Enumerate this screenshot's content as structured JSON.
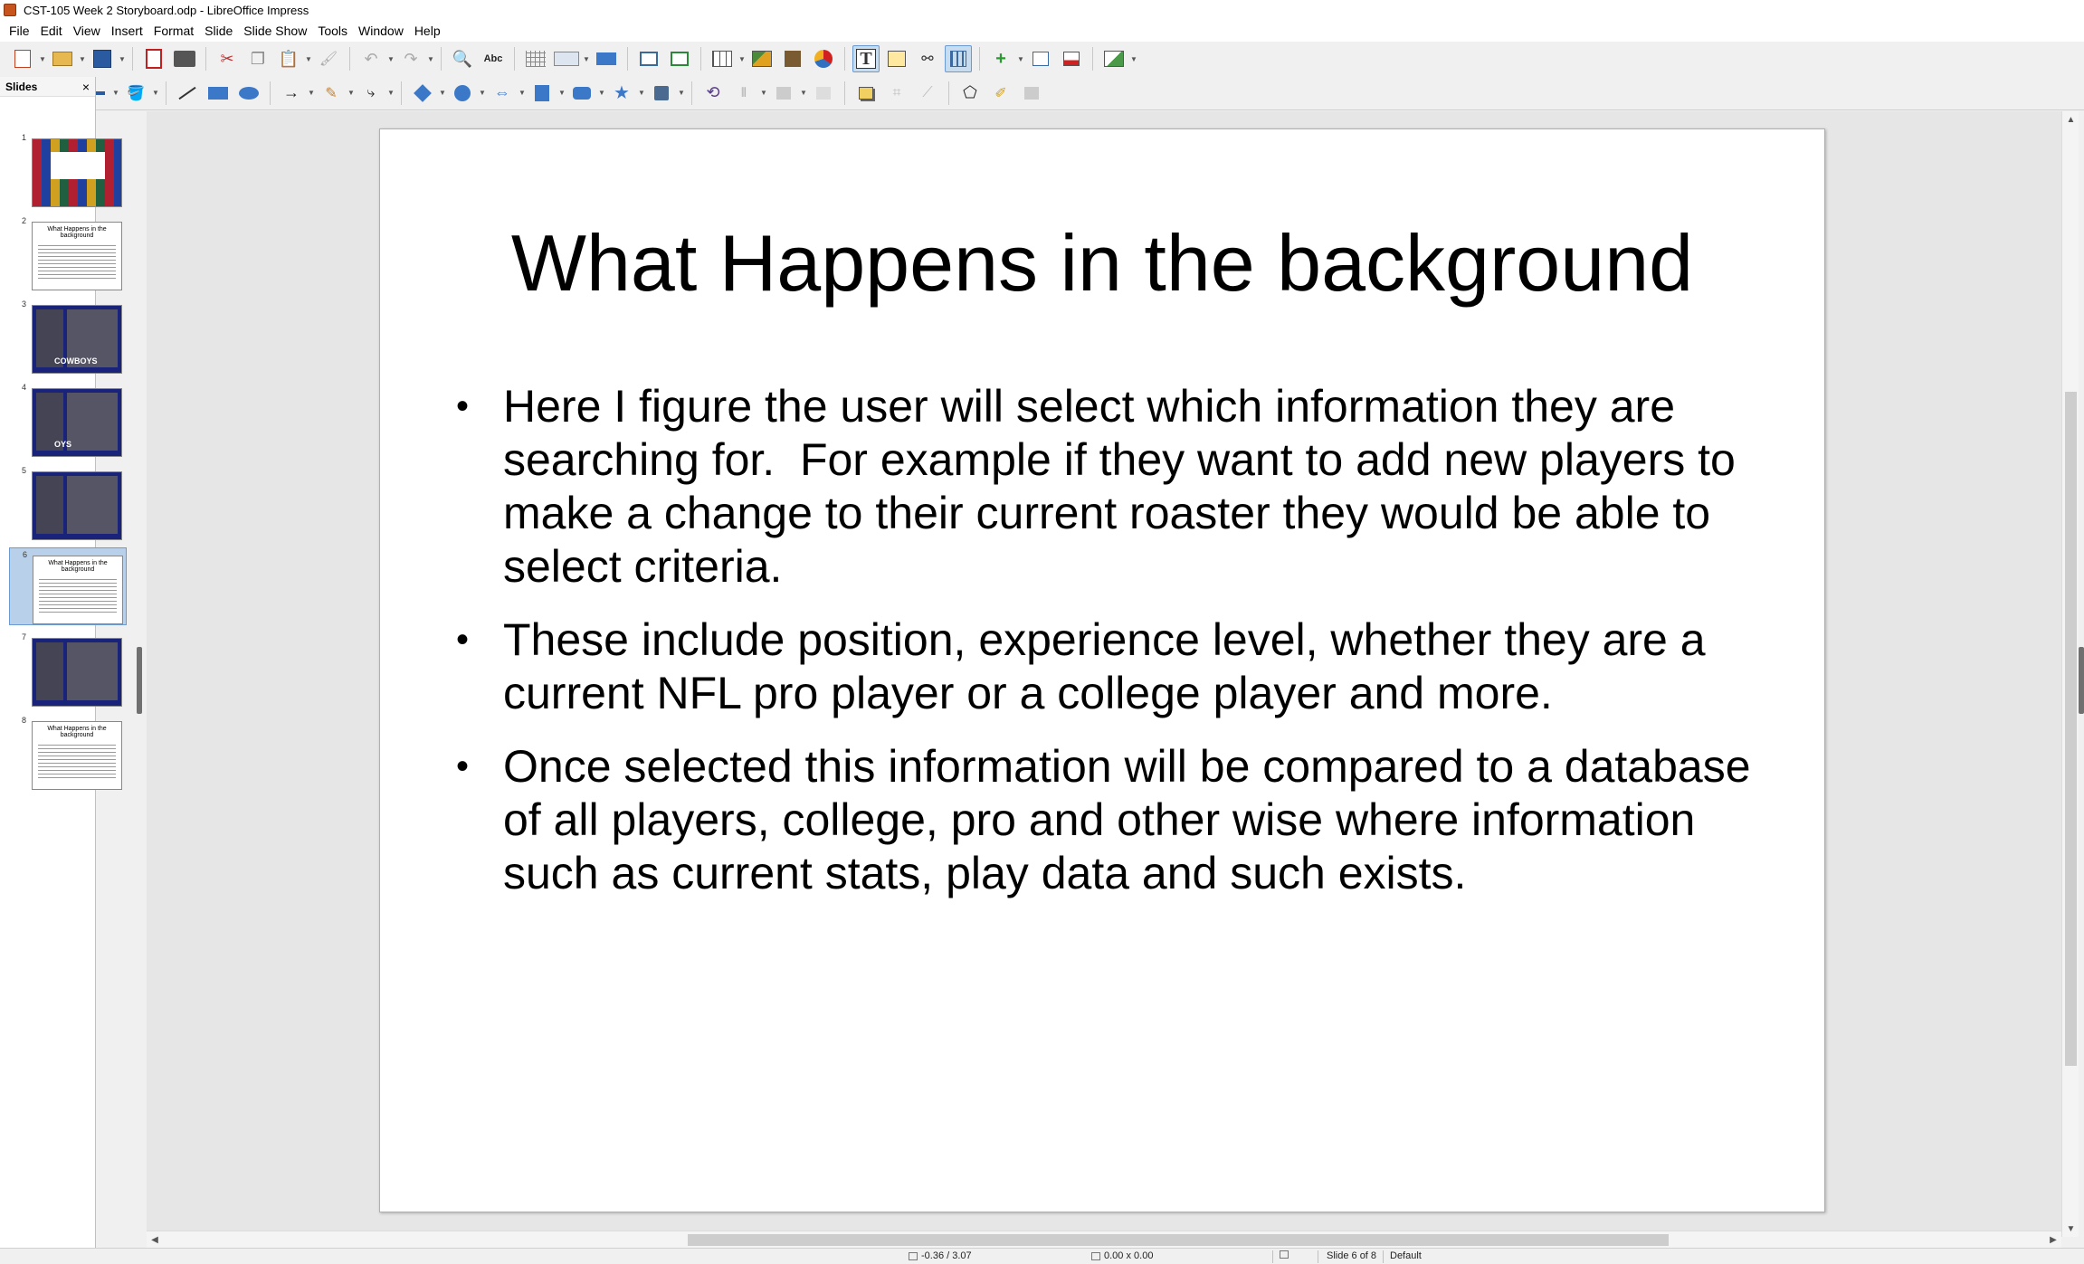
{
  "window": {
    "title": "CST-105 Week 2 Storyboard.odp - LibreOffice Impress"
  },
  "menu": [
    "File",
    "Edit",
    "View",
    "Insert",
    "Format",
    "Slide",
    "Slide Show",
    "Tools",
    "Window",
    "Help"
  ],
  "slide_panel": {
    "title": "Slides",
    "close_label": "×",
    "thumbnails": [
      {
        "number": "1",
        "title": "",
        "style": "mosaic"
      },
      {
        "number": "2",
        "title": "What Happens in the background",
        "style": "text"
      },
      {
        "number": "3",
        "title": "",
        "style": "dark",
        "text": "COWBOYS"
      },
      {
        "number": "4",
        "title": "",
        "style": "dark",
        "text": "OYS"
      },
      {
        "number": "5",
        "title": "",
        "style": "dark",
        "text": ""
      },
      {
        "number": "6",
        "title": "What Happens in the background",
        "style": "text"
      },
      {
        "number": "7",
        "title": "",
        "style": "dark",
        "text": ""
      },
      {
        "number": "8",
        "title": "What Happens in the background",
        "style": "text"
      }
    ],
    "selected_index": 5
  },
  "slide": {
    "title": "What Happens in the background",
    "bullets": [
      "Here I figure the user will select which information they are searching for.  For example if they want to add new players to make a change to their current roaster they would be able to select criteria.",
      "These include position, experience level, whether they are a current NFL pro player or a college player and more.",
      "Once selected this information will be compared to a database of all players, college, pro and other wise where information such as current stats, play data and such exists."
    ],
    "bullet_glyph": "•"
  },
  "statusbar": {
    "position": "-0.36 / 3.07",
    "size": "0.00 x 0.00",
    "slide_info": "Slide 6 of 8",
    "layout": "Default"
  },
  "colors": {
    "selection": "#b8d0ea",
    "slide_bg": "#ffffff",
    "workspace_bg": "#e6e6e6"
  }
}
